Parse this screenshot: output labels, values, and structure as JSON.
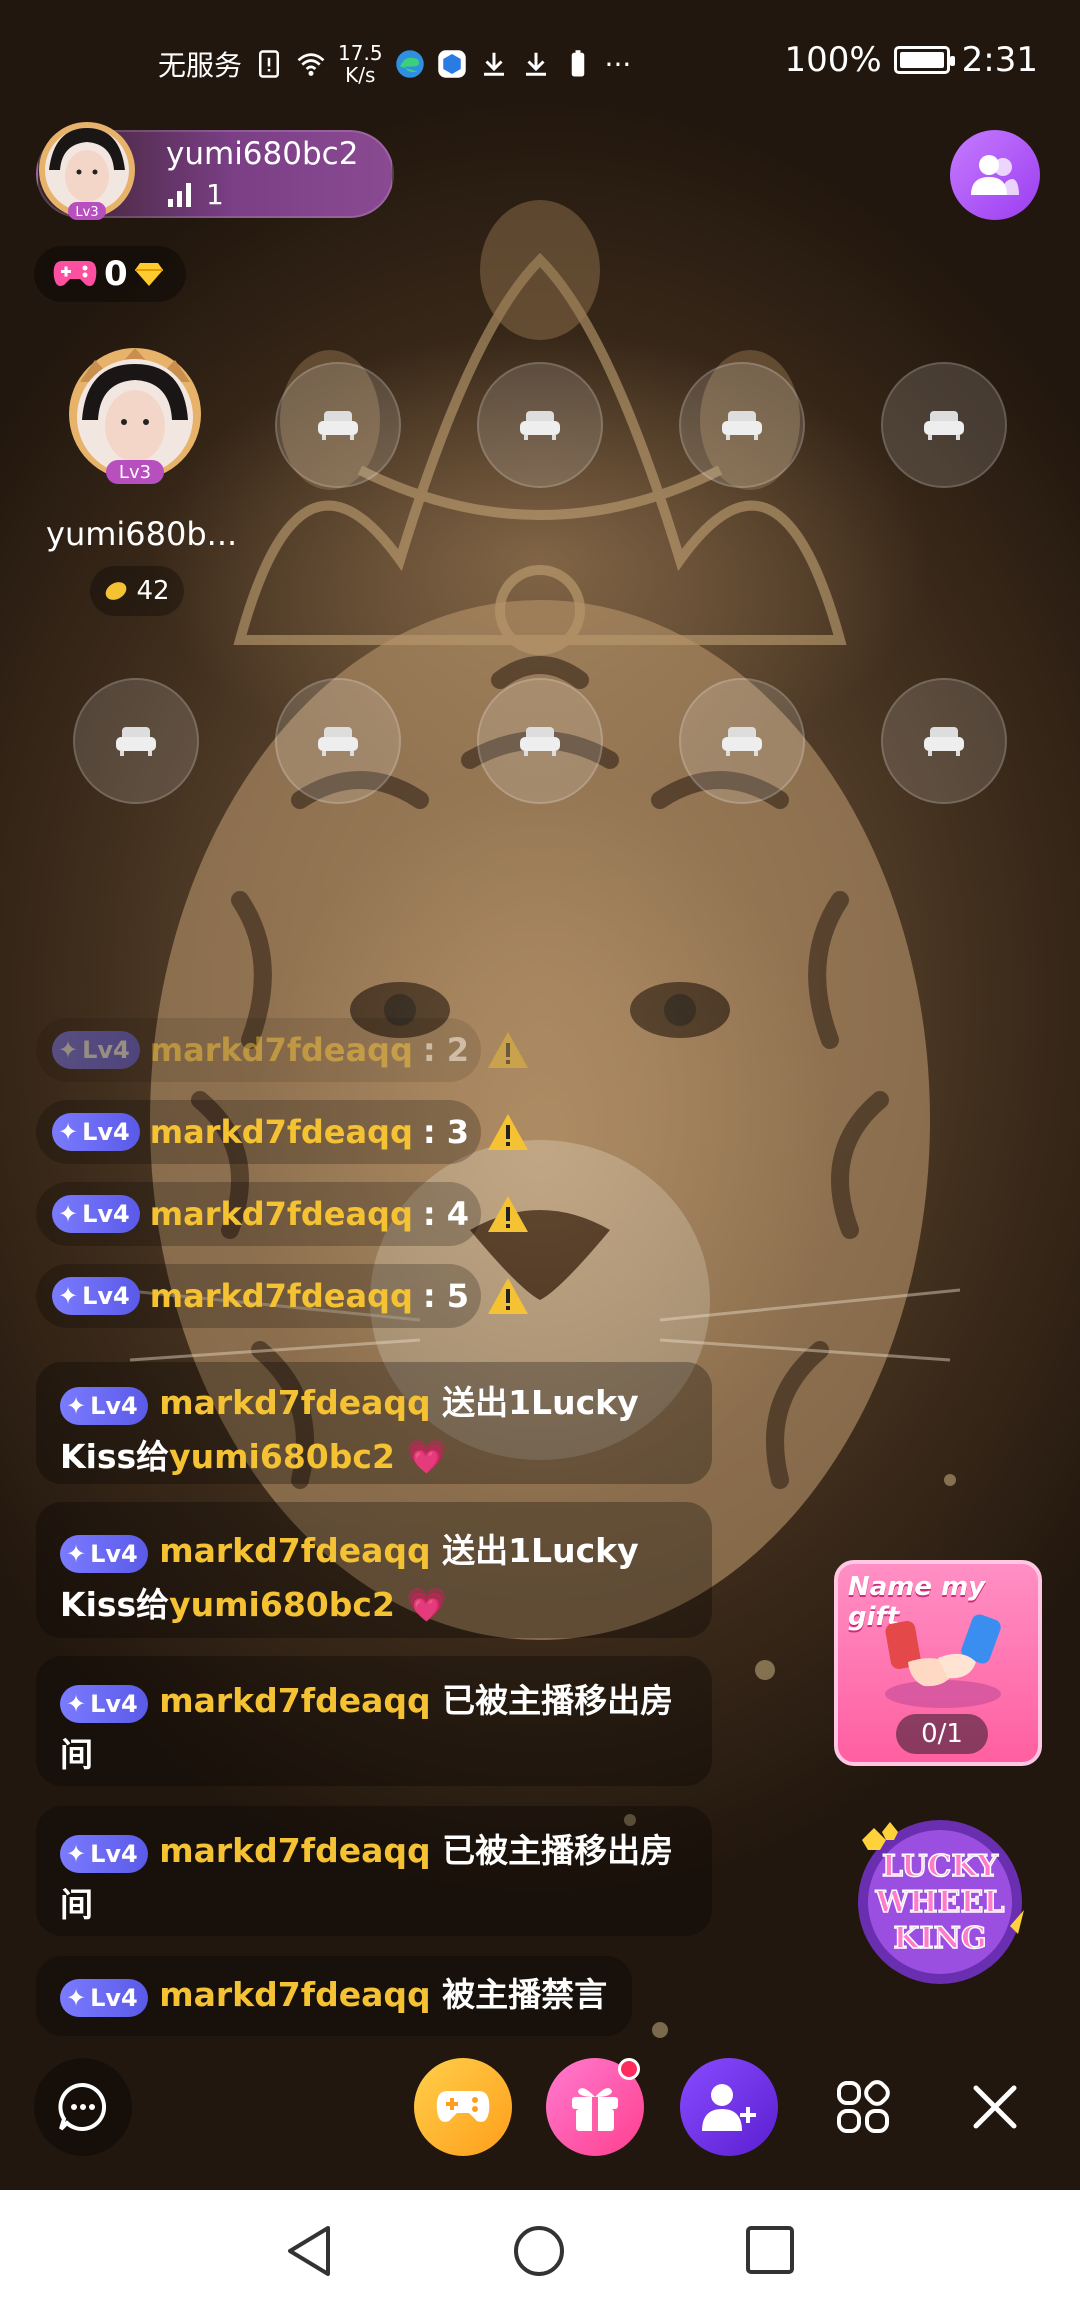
{
  "status_bar": {
    "carrier": "无服务",
    "net_speed_value": "17.5",
    "net_speed_unit": "K/s",
    "battery": "100%",
    "time": "2:31",
    "battery_level": 1.0,
    "more": "···"
  },
  "host": {
    "name": "yumi680bc2",
    "fans": "1",
    "level": "Lv3"
  },
  "game_badge": {
    "count": "0"
  },
  "host_seat": {
    "name": "yumi680b...",
    "score": "42",
    "level": "Lv3"
  },
  "chat": {
    "small": [
      {
        "level": "Lv4",
        "user": "markd7fdeaqq",
        "text": ": 2"
      },
      {
        "level": "Lv4",
        "user": "markd7fdeaqq",
        "text": ": 3"
      },
      {
        "level": "Lv4",
        "user": "markd7fdeaqq",
        "text": ": 4"
      },
      {
        "level": "Lv4",
        "user": "markd7fdeaqq",
        "text": ": 5"
      }
    ],
    "big": [
      {
        "level": "Lv4",
        "user": "markd7fdeaqq",
        "text1": "送出1Lucky",
        "text2": "Kiss给",
        "target": "yumi680bc2"
      },
      {
        "level": "Lv4",
        "user": "markd7fdeaqq",
        "text1": "送出1Lucky",
        "text2": "Kiss给",
        "target": "yumi680bc2"
      },
      {
        "level": "Lv4",
        "user": "markd7fdeaqq",
        "text1": "已被主播移出房",
        "text2": "间"
      },
      {
        "level": "Lv4",
        "user": "markd7fdeaqq",
        "text1": "已被主播移出房",
        "text2": "间"
      },
      {
        "level": "Lv4",
        "user": "markd7fdeaqq",
        "text1": "被主播禁言"
      }
    ]
  },
  "gift_card": {
    "title": "Name my gift",
    "progress": "0/1"
  },
  "wheel": {
    "line1": "LUCKY",
    "line2": "WHEEL",
    "line3": "KING"
  }
}
